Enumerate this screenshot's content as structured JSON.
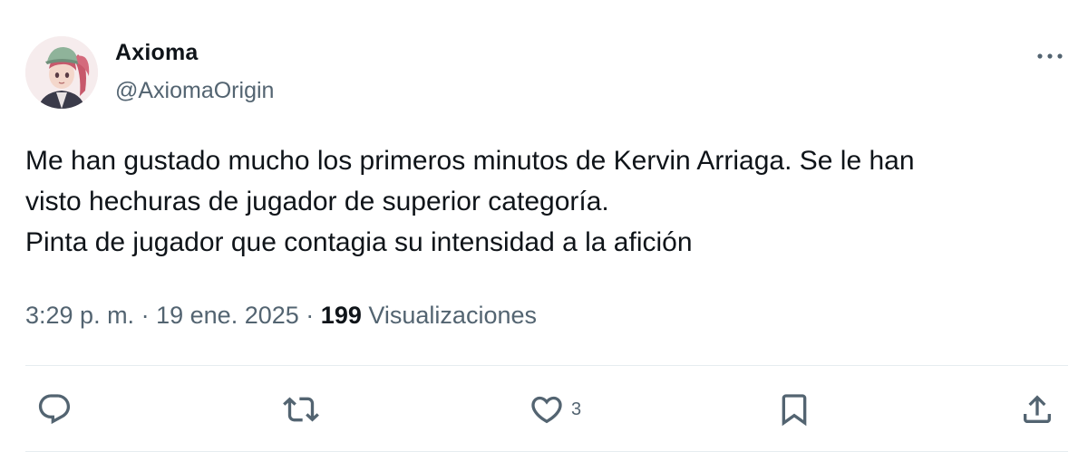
{
  "author": {
    "display_name": "Axioma",
    "handle": "@AxiomaOrigin"
  },
  "header": {
    "more_icon": "more-horizontal-icon"
  },
  "tweet": {
    "lines": [
      "Me han gustado mucho los primeros minutos de Kervin Arriaga. Se le han",
      "visto hechuras de jugador de superior categoría.",
      "Pinta de jugador que contagia su intensidad a la afición"
    ]
  },
  "meta": {
    "time": "3:29 p. m.",
    "separator": "·",
    "date": "19 ene. 2025",
    "views_count": "199",
    "views_label": "Visualizaciones"
  },
  "actions": {
    "reply_icon": "reply-icon",
    "retweet_icon": "retweet-icon",
    "like_icon": "heart-icon",
    "like_count": "3",
    "bookmark_icon": "bookmark-icon",
    "share_icon": "share-icon"
  },
  "colors": {
    "text_primary": "#0f1419",
    "text_secondary": "#536471",
    "divider": "#e6ecf0"
  }
}
